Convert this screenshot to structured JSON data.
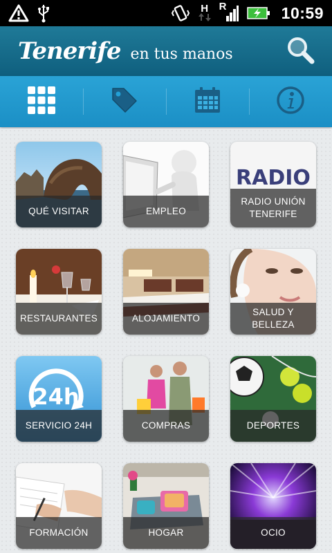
{
  "status_bar": {
    "time": "10:59",
    "network_letter_h": "H",
    "network_letter_r": "R"
  },
  "header": {
    "logo": "Tenerife",
    "tagline": "en tus manos",
    "search_icon": "search-icon"
  },
  "toolbar": {
    "items": [
      {
        "icon": "grid-icon",
        "label": "menu"
      },
      {
        "icon": "tag-icon",
        "label": "ofertas"
      },
      {
        "icon": "calendar-icon",
        "label": "agenda"
      },
      {
        "icon": "info-icon",
        "label": "información"
      }
    ]
  },
  "tiles": [
    {
      "label": "QUÉ VISITAR",
      "icon": "rock-arch-photo"
    },
    {
      "label": "EMPLEO",
      "icon": "figure-computer-photo"
    },
    {
      "label": "RADIO UNIÓN TENERIFE",
      "icon": "radio-logo",
      "logo_text": "RADIO"
    },
    {
      "label": "RESTAURANTES",
      "icon": "table-setting-photo"
    },
    {
      "label": "ALOJAMIENTO",
      "icon": "hotel-room-photo"
    },
    {
      "label": "SALUD Y BELLEZA",
      "icon": "woman-face-photo"
    },
    {
      "label": "SERVICIO 24H",
      "icon": "clock-24h-icon",
      "badge_text": "24h"
    },
    {
      "label": "COMPRAS",
      "icon": "shopping-couple-photo"
    },
    {
      "label": "DEPORTES",
      "icon": "sports-balls-photo"
    },
    {
      "label": "FORMACIÓN",
      "icon": "writing-hands-photo"
    },
    {
      "label": "HOGAR",
      "icon": "living-room-photo"
    },
    {
      "label": "OCIO",
      "icon": "concert-photo"
    }
  ],
  "colors": {
    "appbar": "#177096",
    "toolbar": "#22a0d6",
    "toolbar_icon": "#ffffff",
    "caption_bg": "#282828"
  }
}
